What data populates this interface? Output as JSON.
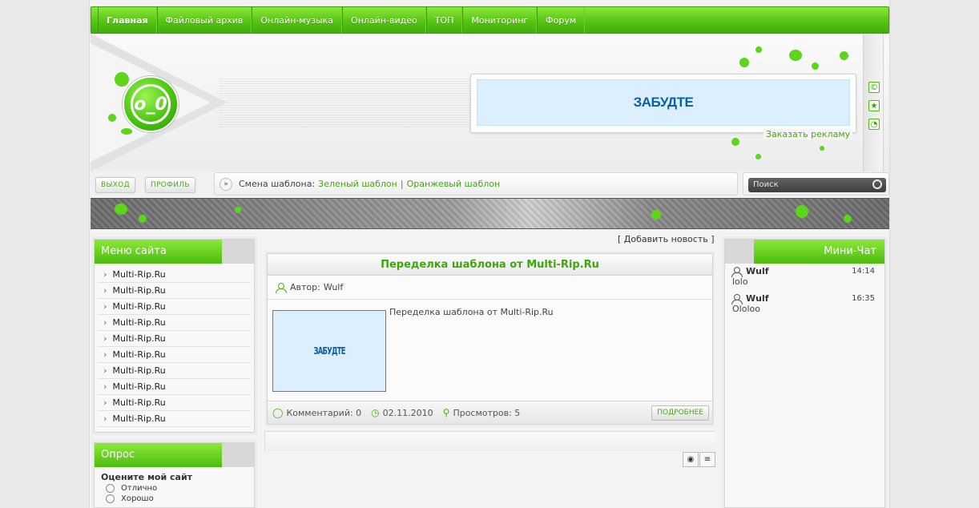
{
  "nav": {
    "items": [
      {
        "label": "Главная"
      },
      {
        "label": "Файловый архив"
      },
      {
        "label": "Онлайн-музыка"
      },
      {
        "label": "Онлайн-видео"
      },
      {
        "label": "ТОП"
      },
      {
        "label": "Мониторинг"
      },
      {
        "label": "Форум"
      }
    ]
  },
  "header": {
    "logo_text": "o_0",
    "banner_text": "ЗАБУДТЕ",
    "ad_link": "Заказать рекламу"
  },
  "userbar": {
    "logout": "ВЫХОД",
    "profile": "ПРОФИЛЬ",
    "template_label": "Смена шаблона:",
    "template_green": "Зеленый шаблон",
    "separator": "|",
    "template_orange": "Оранжевый шаблон",
    "search_placeholder": "Поиск"
  },
  "site_menu": {
    "title": "Меню сайта",
    "items": [
      "Multi-Rip.Ru",
      "Multi-Rip.Ru",
      "Multi-Rip.Ru",
      "Multi-Rip.Ru",
      "Multi-Rip.Ru",
      "Multi-Rip.Ru",
      "Multi-Rip.Ru",
      "Multi-Rip.Ru",
      "Multi-Rip.Ru",
      "Multi-Rip.Ru"
    ]
  },
  "poll": {
    "title": "Опрос",
    "question": "Оцените мой сайт",
    "options": [
      "Отлично",
      "Хорошо"
    ]
  },
  "content": {
    "add_news": "[ Добавить новость ]",
    "news": {
      "title": "Переделка шаблона от Multi-Rip.Ru",
      "author_label": "Автор:",
      "author": "Wulf",
      "thumb_text": "ЗАБУДТЕ",
      "text": "Переделка шаблона от Multi-Rip.Ru",
      "comments": "Комментарий: 0",
      "date": "02.11.2010",
      "views": "Просмотров: 5",
      "more": "ПОДРОБНЕЕ"
    }
  },
  "chat": {
    "title": "Мини-Чат",
    "messages": [
      {
        "user": "Wulf",
        "time": "14:14",
        "text": "lolo"
      },
      {
        "user": "Wulf",
        "time": "16:35",
        "text": "Ololoo"
      }
    ]
  },
  "colors": {
    "accent": "#4dbb10",
    "link": "#40a910",
    "banner_text": "#0b5fa5"
  }
}
